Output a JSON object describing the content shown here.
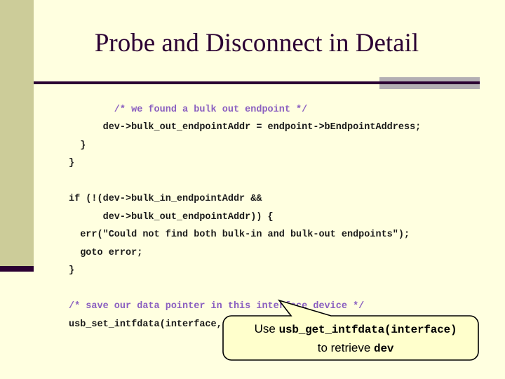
{
  "slide": {
    "title": "Probe and Disconnect in Detail",
    "background_color": "#FFFFE0",
    "accent_band_color": "#CCCC99",
    "accent_dark_color": "#2B0033",
    "divider_gray_color": "#B3AFB3",
    "title_color": "#2B0033"
  },
  "code": {
    "comment_color": "#8A5FC0",
    "text_color": "#1A1A1A",
    "lines": [
      {
        "indent": 4,
        "text": "/* we found a bulk out endpoint */",
        "kind": "comment"
      },
      {
        "indent": 3,
        "text": "dev->bulk_out_endpointAddr = endpoint->bEndpointAddress;",
        "kind": "code"
      },
      {
        "indent": 1,
        "text": "}",
        "kind": "code"
      },
      {
        "indent": 0,
        "text": "}",
        "kind": "code"
      },
      {
        "indent": 0,
        "text": "",
        "kind": "blank"
      },
      {
        "indent": 0,
        "text": "if (!(dev->bulk_in_endpointAddr &&",
        "kind": "code"
      },
      {
        "indent": 3,
        "text": "dev->bulk_out_endpointAddr)) {",
        "kind": "code"
      },
      {
        "indent": 1,
        "text": "err(\"Could not find both bulk-in and bulk-out endpoints\");",
        "kind": "code"
      },
      {
        "indent": 1,
        "text": "goto error;",
        "kind": "code"
      },
      {
        "indent": 0,
        "text": "}",
        "kind": "code"
      },
      {
        "indent": 0,
        "text": "",
        "kind": "blank"
      },
      {
        "indent": 0,
        "text": "/* save our data pointer in this interface device */",
        "kind": "comment"
      },
      {
        "indent": 0,
        "text": "usb_set_intfdata(interface, dev);",
        "kind": "code"
      }
    ]
  },
  "callout": {
    "fill_color": "#FFFFCC",
    "border_color": "#000000",
    "line1_prefix": "Use ",
    "line1_mono": "usb_get_intfdata(interface)",
    "line2_prefix": "to retrieve ",
    "line2_mono": "dev"
  }
}
